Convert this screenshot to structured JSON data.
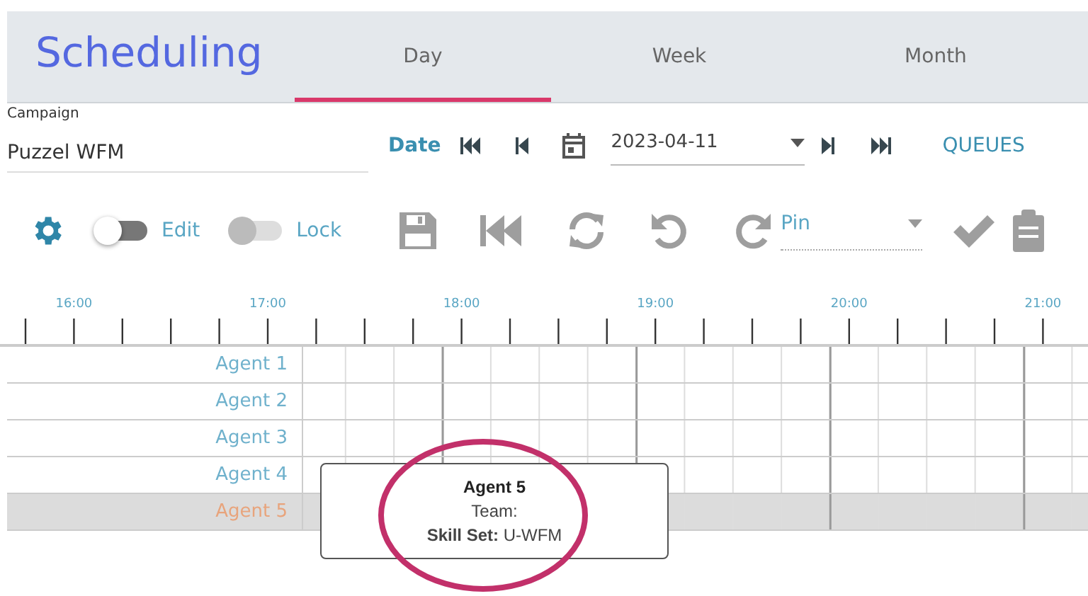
{
  "header": {
    "title": "Scheduling",
    "tabs": [
      {
        "label": "Day",
        "selected": true
      },
      {
        "label": "Week",
        "selected": false
      },
      {
        "label": "Month",
        "selected": false
      }
    ]
  },
  "filters": {
    "campaign_label": "Campaign",
    "campaign_value": "Puzzel WFM",
    "date_label": "Date",
    "date_value": "2023-04-11",
    "queues_link": "QUEUES"
  },
  "toolbar": {
    "toggles": [
      {
        "label": "Edit",
        "on": false,
        "disabled": false
      },
      {
        "label": "Lock",
        "on": false,
        "disabled": true
      }
    ],
    "pin_label": "Pin"
  },
  "timeline": {
    "hours": [
      "16:00",
      "17:00",
      "18:00",
      "19:00",
      "20:00",
      "21:00"
    ]
  },
  "agents": [
    {
      "name": "Agent 1",
      "selected": false
    },
    {
      "name": "Agent 2",
      "selected": false
    },
    {
      "name": "Agent 3",
      "selected": false
    },
    {
      "name": "Agent 4",
      "selected": false
    },
    {
      "name": "Agent 5",
      "selected": true
    }
  ],
  "tooltip": {
    "title": "Agent 5",
    "team_label": "Team:",
    "skill_label": "Skill Set:",
    "skill_value": "U-WFM"
  }
}
